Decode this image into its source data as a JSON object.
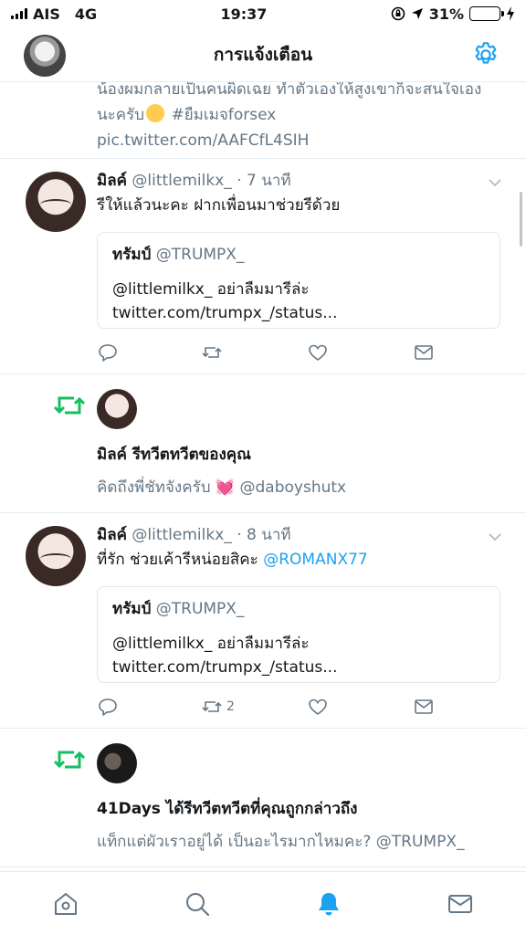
{
  "status_bar": {
    "carrier": "AIS",
    "network": "4G",
    "time": "19:37",
    "battery": "31%",
    "battery_level": 0.31,
    "battery_color": "#4cd964"
  },
  "header": {
    "title": "การแจ้งเตือน",
    "settings_icon": "gear-icon",
    "accent_color": "#1da1f2"
  },
  "partial_tweet": {
    "text": "น้องผมกลายเป็นคนผิดเฉย ทำตัวเองให้สูงเขาก็จะสนใจเองนะครับ",
    "hashtag": "#ยืมเมจforsex",
    "link": "pic.twitter.com/AAFCfL4SIH"
  },
  "tweets": [
    {
      "name": "มิลค์",
      "handle": "@littlemilkx_",
      "time": "· 7 นาที",
      "text": "รีให้แล้วนะคะ ฝากเพื่อนมาช่วยรีด้วย",
      "mention": "",
      "quote": {
        "name": "ทรัมป์",
        "handle": "@TRUMPX_",
        "text": "@littlemilkx_ อย่าลืมมารีล่ะ twitter.com/trumpx_/status..."
      },
      "retweet_count": ""
    },
    {
      "name": "มิลค์",
      "handle": "@littlemilkx_",
      "time": "· 8 นาที",
      "text": "ที่รัก ช่วยเค้ารีหน่อยสิคะ",
      "mention": "@ROMANX77",
      "quote": {
        "name": "ทรัมป์",
        "handle": "@TRUMPX_",
        "text": "@littlemilkx_ อย่าลืมมารีล่ะ twitter.com/trumpx_/status..."
      },
      "retweet_count": "2"
    }
  ],
  "notifications": [
    {
      "title": "มิลค์ รีทวีตทวีตของคุณ",
      "text": "คิดถึงพี่ชัทจังครับ",
      "emoji": "💓",
      "mention": "@daboyshutx"
    },
    {
      "title": "41Days ได้รีทวีตทวีตที่คุณถูกกล่าวถึง",
      "text": "แท็กแต่ผัวเราอยู่ได้ เป็นอะไรมากไหมคะ? @TRUMPX_"
    }
  ],
  "tabbar": {
    "items": [
      "home-icon",
      "search-icon",
      "notifications-icon",
      "messages-icon"
    ],
    "active": "notifications-icon",
    "retweet_color": "#17bf63"
  }
}
